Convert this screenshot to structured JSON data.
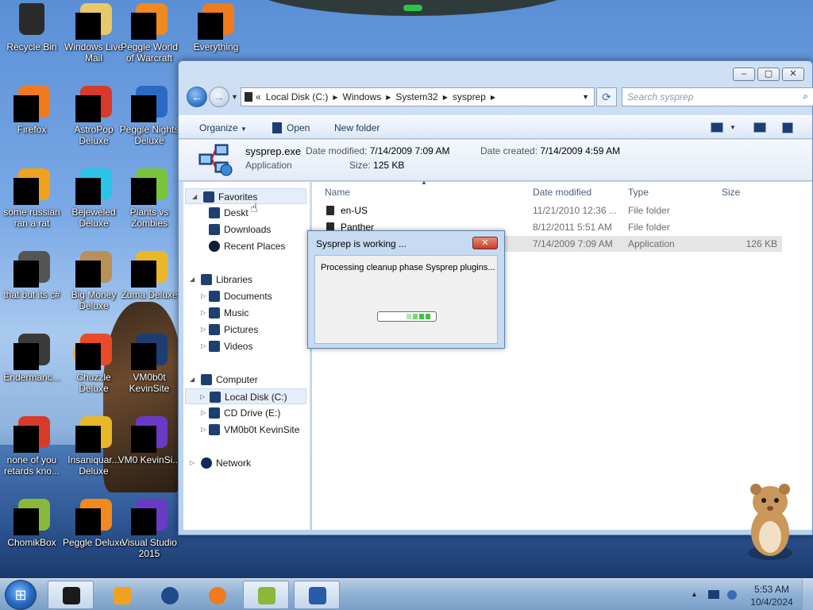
{
  "desktop": {
    "icons": [
      {
        "label": "Recycle Bin",
        "icon": "recycle-bin-icon",
        "color": "#2b2b2b"
      },
      {
        "label": "Windows Live Mail",
        "icon": "mail-icon",
        "color": "#e8c96a"
      },
      {
        "label": "Peggle World of Warcraft",
        "icon": "peggle-icon",
        "color": "#f08a1e"
      },
      {
        "label": "Everything",
        "icon": "search-icon",
        "color": "#f07a1e"
      },
      {
        "label": "Firefox",
        "icon": "firefox-icon",
        "color": "#f07a1e"
      },
      {
        "label": "AstroPop Deluxe",
        "icon": "astropop-icon",
        "color": "#d83a2a"
      },
      {
        "label": "Peggle Nights Deluxe",
        "icon": "peggle-nights-icon",
        "color": "#2a6ac4"
      },
      {
        "label": "some russian ran a rat",
        "icon": "game-icon",
        "color": "#f0a21e"
      },
      {
        "label": "Bejeweled Deluxe",
        "icon": "gem-icon",
        "color": "#2ac4e8"
      },
      {
        "label": "Plants vs Zombies",
        "icon": "plant-icon",
        "color": "#7ac43a"
      },
      {
        "label": "that but its c#",
        "icon": "shortcut-icon",
        "color": "#555555"
      },
      {
        "label": "Big Money Deluxe",
        "icon": "money-bag-icon",
        "color": "#b8905a"
      },
      {
        "label": "Zuma Deluxe",
        "icon": "zuma-icon",
        "color": "#e8b82a"
      },
      {
        "label": "Endermanc...",
        "icon": "app-icon",
        "color": "#3a3a3a"
      },
      {
        "label": "Chuzzle Deluxe",
        "icon": "chuzzle-icon",
        "color": "#e84a2a"
      },
      {
        "label": "VM0b0t KevinSite",
        "icon": "monitor-icon",
        "color": "#1e3d73"
      },
      {
        "label": "none of you retards kno...",
        "icon": "chrome-icon",
        "color": "#d83a2a"
      },
      {
        "label": "Insaniquar... Deluxe",
        "icon": "insaniquarium-icon",
        "color": "#e8b82a"
      },
      {
        "label": "VM0 KevinSi...",
        "icon": "vm-icon",
        "color": "#6a3ac4"
      },
      {
        "label": "ChomikBox",
        "icon": "chomikbox-icon",
        "color": "#8ab83a"
      },
      {
        "label": "Peggle Deluxe",
        "icon": "peggle-deluxe-icon",
        "color": "#f08a1e"
      },
      {
        "label": "Visual Studio 2015",
        "icon": "visual-studio-icon",
        "color": "#6a3ac4"
      }
    ]
  },
  "explorer": {
    "caption": {
      "minimize": "‒",
      "maximize": "▢",
      "close": "✕"
    },
    "address": {
      "crumbs": [
        "Local Disk (C:)",
        "Windows",
        "System32",
        "sysprep"
      ],
      "prefix": "«"
    },
    "search": {
      "placeholder": "Search sysprep"
    },
    "command_bar": {
      "organize": "Organize",
      "open": "Open",
      "new_folder": "New folder"
    },
    "details": {
      "name": "sysprep.exe",
      "type": "Application",
      "date_modified_label": "Date modified:",
      "date_modified": "7/14/2009 7:09 AM",
      "date_created_label": "Date created:",
      "date_created": "7/14/2009 4:59 AM",
      "size_label": "Size:",
      "size": "125 KB"
    },
    "nav": {
      "favorites": "Favorites",
      "desktop": "Deskt",
      "downloads": "Downloads",
      "recent_places": "Recent Places",
      "libraries": "Libraries",
      "documents": "Documents",
      "music": "Music",
      "pictures": "Pictures",
      "videos": "Videos",
      "computer": "Computer",
      "local_disk": "Local Disk (C:)",
      "cd_drive": "CD Drive (E:)",
      "vm_site": "VM0b0t KevinSite",
      "network": "Network"
    },
    "columns": {
      "name": "Name",
      "date_modified": "Date modified",
      "type": "Type",
      "size": "Size"
    },
    "files": [
      {
        "name": "en-US",
        "date": "11/21/2010 12:36 ...",
        "type": "File folder",
        "size": ""
      },
      {
        "name": "Panther",
        "date": "8/12/2011 5:51 AM",
        "type": "File folder",
        "size": ""
      },
      {
        "name": "sysprep.exe",
        "date": "7/14/2009 7:09 AM",
        "type": "Application",
        "size": "126 KB"
      }
    ]
  },
  "dialog": {
    "title": "Sysprep is working ...",
    "message": "Processing cleanup phase Sysprep plugins...",
    "close": "✕"
  },
  "taskbar": {
    "clock_time": "5:53 AM",
    "clock_date": "10/4/2024",
    "tray_up": "▲"
  }
}
